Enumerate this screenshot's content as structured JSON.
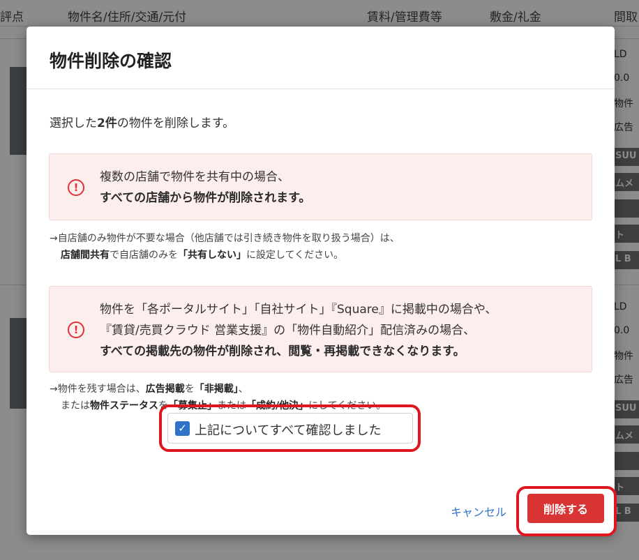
{
  "background": {
    "columns": [
      "評点",
      "物件名/住所/交通/元付",
      "賃料/管理費等",
      "敷金/礼金",
      "間取"
    ],
    "right_fragments": [
      "LD",
      "0.0",
      "物件",
      "広告",
      "LD",
      "0.0",
      "物件",
      "広告"
    ],
    "right_buttons": [
      "SUU",
      "ムメ",
      "",
      "ト",
      "L B",
      "SUU",
      "ムメ",
      "",
      "ト",
      "L B"
    ]
  },
  "modal": {
    "title": "物件削除の確認",
    "lead_prefix": "選択した",
    "lead_count": "2件",
    "lead_suffix": "の物件を削除します。",
    "alert1": {
      "icon": "exclamation-circle-icon",
      "line1": "複数の店舗で物件を共有中の場合、",
      "line2": "すべての店舗から物件が削除されます。"
    },
    "note1": {
      "line1": "→自店舗のみ物件が不要な場合（他店舗では引き続き物件を取り扱う場合）は、",
      "line2_bold_a": "店舗間共有",
      "line2_text_a": "で自店舗のみを",
      "line2_bold_b": "「共有しない」",
      "line2_text_b": "に設定してください。"
    },
    "alert2": {
      "icon": "exclamation-circle-icon",
      "line1": "物件を「各ポータルサイト」「自社サイト」『Square』に掲載中の場合や、",
      "line2": "『賃貸/売買クラウド 営業支援』の「物件自動紹介」配信済みの場合、",
      "line3": "すべての掲載先の物件が削除され、閲覧・再掲載できなくなります。"
    },
    "note2": {
      "line1_text_a": "→物件を残す場合は、",
      "line1_bold_a": "広告掲載",
      "line1_text_b": "を",
      "line1_bold_b": "「非掲載」",
      "line1_text_c": "、",
      "line2_text_a": "または",
      "line2_bold_a": "物件ステータス",
      "line2_text_b": "を",
      "line2_bold_b": "「募集止」",
      "line2_text_c": "または",
      "line2_bold_c": "「成約/他決」",
      "line2_text_d": "にしてください。"
    },
    "confirm_checkbox": {
      "checked": true,
      "check_glyph": "✓",
      "label": "上記についてすべて確認しました"
    },
    "cancel_label": "キャンセル",
    "delete_label": "削除する"
  },
  "colors": {
    "accent_blue": "#2f73c9",
    "danger_red": "#d93434",
    "highlight_red": "#e0151d",
    "alert_bg": "#fdeeee"
  }
}
